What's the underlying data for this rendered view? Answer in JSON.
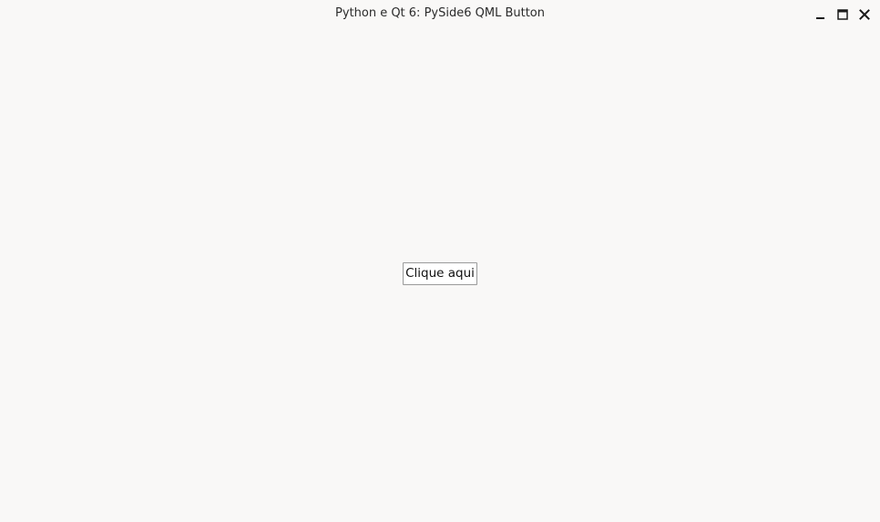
{
  "window": {
    "title": "Python e Qt 6: PySide6 QML Button",
    "controls": [
      "minimize-icon",
      "maximize-icon",
      "close-icon"
    ]
  },
  "main": {
    "button_label": "Clique aqui"
  },
  "colors": {
    "background": "#f9f8f7",
    "text": "#2b2b2b",
    "button_border": "#9a9a9a"
  }
}
